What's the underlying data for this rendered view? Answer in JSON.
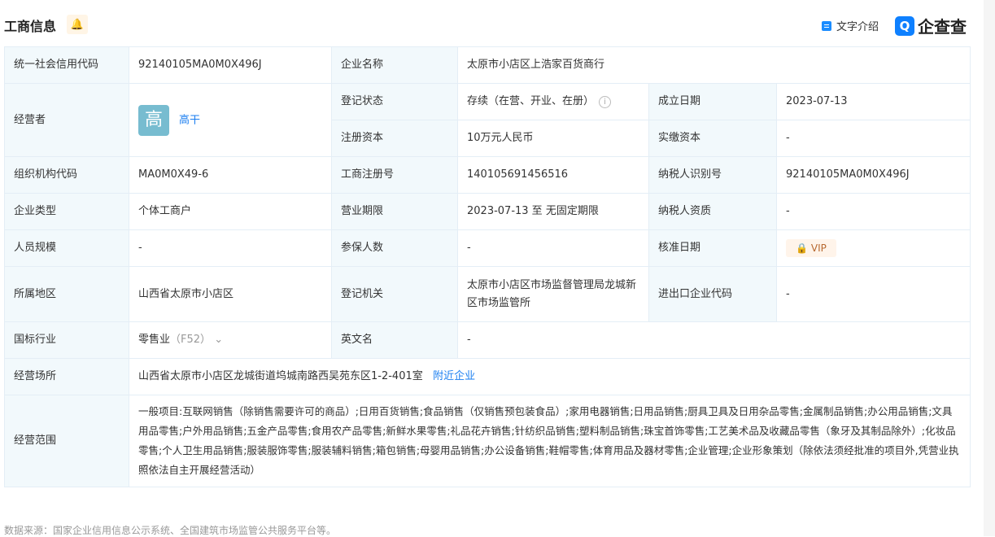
{
  "header": {
    "title": "工商信息",
    "intro": "文字介绍",
    "logo": "企查查"
  },
  "rows": {
    "credit_code_label": "统一社会信用代码",
    "credit_code": "92140105MA0M0X496J",
    "name_label": "企业名称",
    "name": "太原市小店区上浩家百货商行",
    "operator_label": "经营者",
    "operator_avatar": "高",
    "operator": "高干",
    "status_label": "登记状态",
    "status": "存续（在营、开业、在册）",
    "found_label": "成立日期",
    "found": "2023-07-13",
    "capital_label": "注册资本",
    "capital": "10万元人民币",
    "paid_label": "实缴资本",
    "paid": "-",
    "org_label": "组织机构代码",
    "org": "MA0M0X49-6",
    "reg_no_label": "工商注册号",
    "reg_no": "140105691456516",
    "tax_id_label": "纳税人识别号",
    "tax_id": "92140105MA0M0X496J",
    "type_label": "企业类型",
    "type": "个体工商户",
    "term_label": "营业期限",
    "term": "2023-07-13 至 无固定期限",
    "tax_qual_label": "纳税人资质",
    "tax_qual": "-",
    "staff_label": "人员规模",
    "staff": "-",
    "insured_label": "参保人数",
    "insured": "-",
    "approve_label": "核准日期",
    "approve_vip": "VIP",
    "region_label": "所属地区",
    "region": "山西省太原市小店区",
    "authority_label": "登记机关",
    "authority": "太原市小店区市场监督管理局龙城新区市场监管所",
    "ie_label": "进出口企业代码",
    "ie": "-",
    "industry_label": "国标行业",
    "industry": "零售业",
    "industry_code": "（F52）",
    "en_label": "英文名",
    "en": "-",
    "address_label": "经营场所",
    "address": "山西省太原市小店区龙城街道坞城南路西吴苑东区1-2-401室",
    "nearby": "附近企业",
    "scope_label": "经营范围",
    "scope": "一般项目:互联网销售（除销售需要许可的商品）;日用百货销售;食品销售（仅销售预包装食品）;家用电器销售;日用品销售;厨具卫具及日用杂品零售;金属制品销售;办公用品销售;文具用品零售;户外用品销售;五金产品零售;食用农产品零售;新鲜水果零售;礼品花卉销售;针纺织品销售;塑料制品销售;珠宝首饰零售;工艺美术品及收藏品零售（象牙及其制品除外）;化妆品零售;个人卫生用品销售;服装服饰零售;服装辅料销售;箱包销售;母婴用品销售;办公设备销售;鞋帽零售;体育用品及器材零售;企业管理;企业形象策划（除依法须经批准的项目外,凭营业执照依法自主开展经营活动）"
  },
  "footer": "数据来源：国家企业信用信息公示系统、全国建筑市场监管公共服务平台等。"
}
